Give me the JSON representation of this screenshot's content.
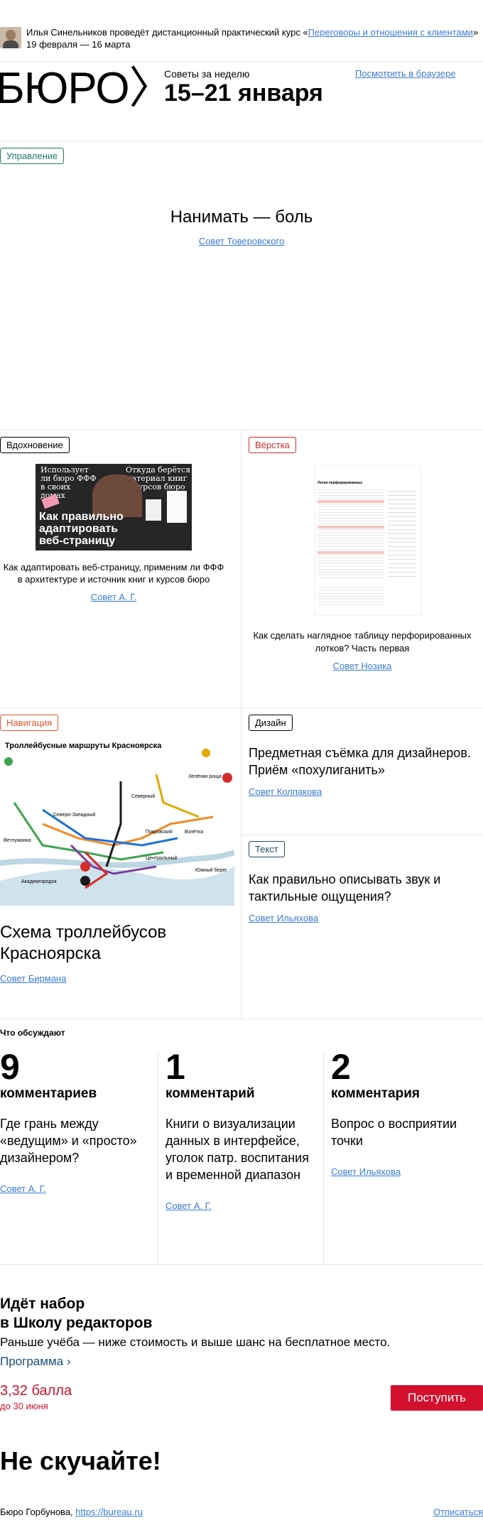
{
  "announcement": {
    "text_before": "Илья Синельников проведёт дистанционный практический курс «",
    "link": "Переговоры и отношения с клиентами",
    "text_after": "»",
    "dates": "19 февраля — 16 марта"
  },
  "header": {
    "logo": "БЮРО",
    "subtitle": "Советы за неделю",
    "title": "15–21 января",
    "browser_link": "Посмотреть в браузере"
  },
  "featured": {
    "tag": "Управление",
    "title": "Нанимать — боль",
    "link": "Совет Товеровского"
  },
  "card_inspiration": {
    "tag": "Вдохновение",
    "img_left": "Использует ли бюро ФФФ в своих домах",
    "img_right": "Откуда берётся материал книг и курсов бюро",
    "img_main1": "Как правильно",
    "img_main2": "адаптировать",
    "img_main3": "веб-страницу",
    "title": "Как адаптировать веб-страницу, применим ли ФФФ в архитектуре и источник книг и курсов бюро",
    "link": "Совет А. Г."
  },
  "card_layout": {
    "tag": "Вёрстка",
    "doc_title": "Лотки перфорированные",
    "title": "Как сделать наглядное таблицу перфорированных лотков? Часть первая",
    "link": "Совет Нозика"
  },
  "card_navigation": {
    "tag": "Навигация",
    "map_title": "Троллейбусные маршруты Красноярска",
    "map_labels": [
      "Северный",
      "Покровский",
      "Взлётка",
      "Центральный",
      "Ветлужанка",
      "Академгородок",
      "Южный берег",
      "Зелёная роща",
      "Северо-Западный"
    ],
    "title": "Схема троллейбусов Красноярска",
    "link": "Совет Бирмана"
  },
  "card_design": {
    "tag": "Дизайн",
    "title": "Предметная съёмка для дизайнеров. Приём «похулиганить»",
    "link": "Совет Колпакова"
  },
  "card_text": {
    "tag": "Текст",
    "title": "Как правильно описывать звук и тактильные ощущения?",
    "link": "Совет Ильяхова"
  },
  "discussion": {
    "heading": "Что обсуждают",
    "items": [
      {
        "count": "9",
        "word": "комментариев",
        "question": "Где грань между «ведущим» и «просто» дизайнером?",
        "link": "Совет А. Г."
      },
      {
        "count": "1",
        "word": "комментарий",
        "question": "Книги о визуализации данных в интерфейсе, уголок патр. воспитания и временной диапазон",
        "link": "Совет А. Г."
      },
      {
        "count": "2",
        "word": "комментария",
        "question": "Вопрос о восприятии точки",
        "link": "Совет Ильяхова"
      }
    ]
  },
  "promo": {
    "title_line1": "Идёт набор",
    "title_line2": "в Школу редакторов",
    "subtitle": "Раньше учёба — ниже стоимость и выше шанс на бесплатное место.",
    "program": "Программа",
    "score": "3,32 балла",
    "deadline": "до 30 июня",
    "button": "Поступить"
  },
  "footer": {
    "slogan": "Не скучайте!",
    "org": "Бюро Горбунова, ",
    "site": "https://bureau.ru",
    "unsubscribe": "Отписаться"
  },
  "colors": {
    "link": "#3a7bd5",
    "accent_red": "#d3112e",
    "promo_blue": "#1a4f7c"
  }
}
